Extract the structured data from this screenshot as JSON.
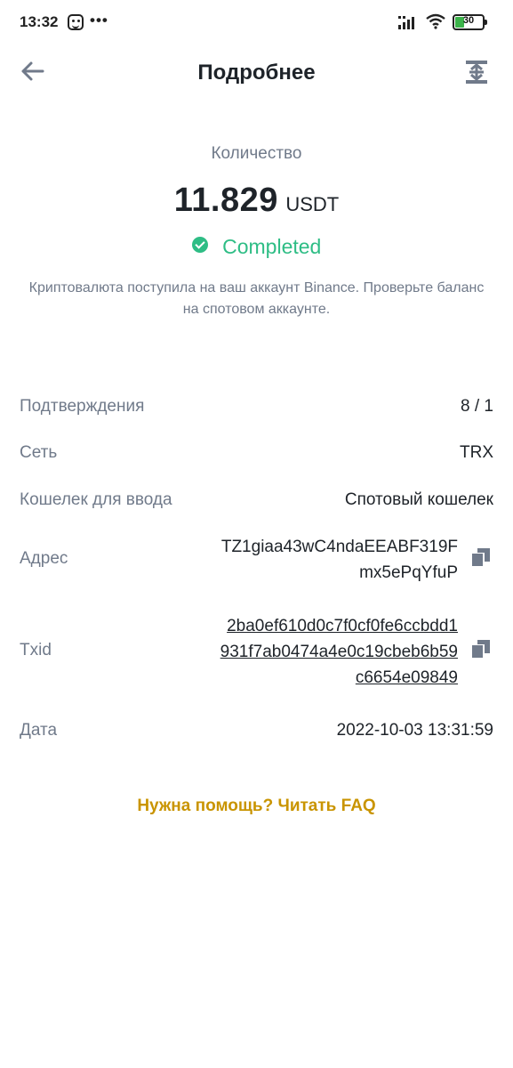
{
  "status_bar": {
    "time": "13:32",
    "dots": "•••",
    "battery": "30",
    "battery_color": "#3cb34a"
  },
  "header": {
    "title": "Подробнее",
    "back_icon": "arrow-left-icon",
    "share_icon": "share-icon"
  },
  "summary": {
    "amount_label": "Количество",
    "amount": "11.829",
    "unit": "USDT",
    "status": "Completed",
    "status_color": "#2ebd85",
    "description": "Криптовалюта поступила на ваш аккаунт Binance. Проверьте баланс на спотовом аккаунте."
  },
  "details": {
    "confirmations": {
      "label": "Подтверждения",
      "value": "8 / 1"
    },
    "network": {
      "label": "Сеть",
      "value": "TRX"
    },
    "wallet": {
      "label": "Кошелек для ввода",
      "value": "Спотовый кошелек"
    },
    "address": {
      "label": "Адрес",
      "line1": "TZ1giaa43wC4ndaEEABF319F",
      "line2": "mx5ePqYfuP"
    },
    "txid": {
      "label": "Txid",
      "line1": "2ba0ef610d0c7f0cf0fe6ccbdd1",
      "line2": "931f7ab0474a4e0c19cbeb6b59",
      "line3": "c6654e09849"
    },
    "date": {
      "label": "Дата",
      "value": "2022-10-03 13:31:59"
    }
  },
  "faq_link": "Нужна помощь? Читать FAQ",
  "accent_color": "#c99400"
}
